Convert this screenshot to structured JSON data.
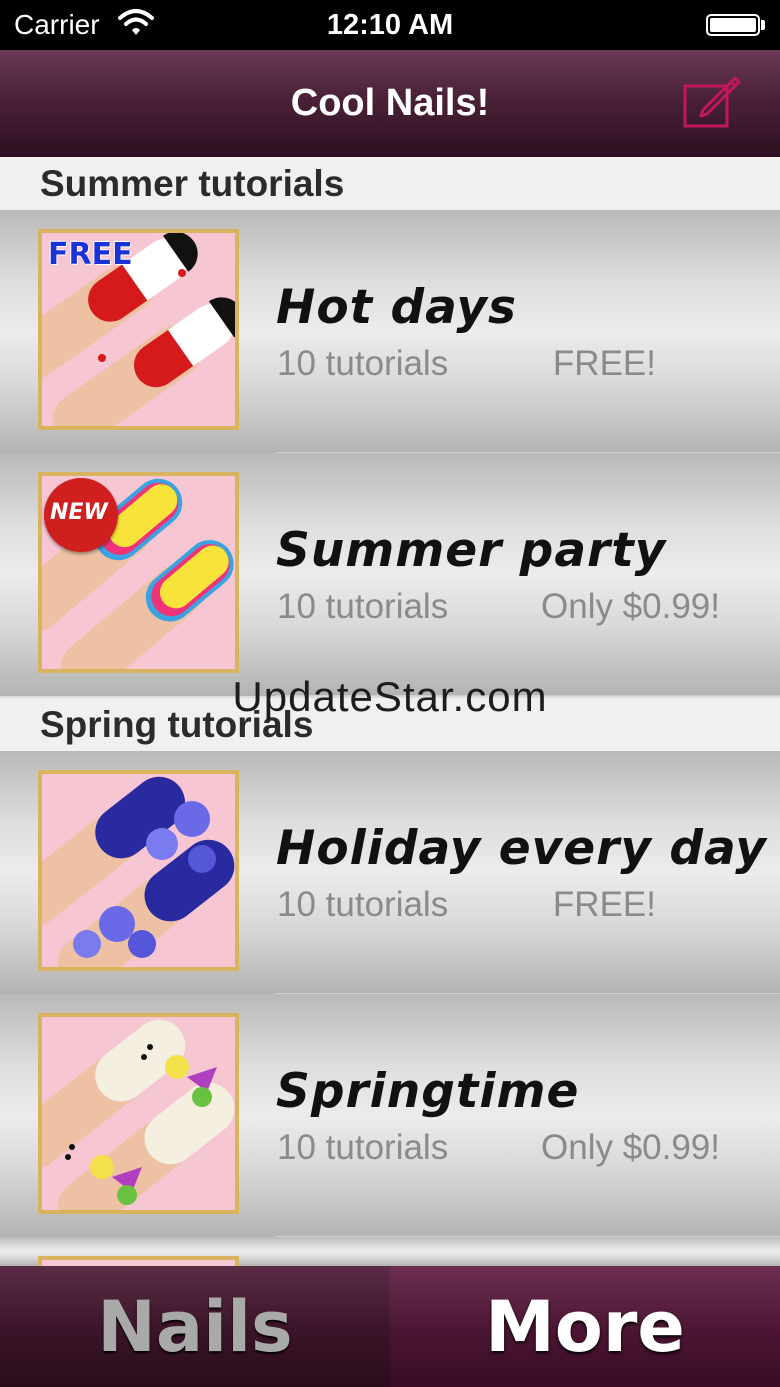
{
  "status_bar": {
    "carrier": "Carrier",
    "time": "12:10 AM"
  },
  "nav": {
    "title": "Cool Nails!"
  },
  "sections": [
    {
      "title": "Summer tutorials",
      "items": [
        {
          "title": "Hot days",
          "count": "10 tutorials",
          "price": "FREE!",
          "badge": "FREE"
        },
        {
          "title": "Summer party",
          "count": "10 tutorials",
          "price": "Only $0.99!",
          "badge": "NEW"
        }
      ]
    },
    {
      "title": "Spring tutorials",
      "items": [
        {
          "title": "Holiday every day",
          "count": "10 tutorials",
          "price": "FREE!"
        },
        {
          "title": "Springtime",
          "count": "10 tutorials",
          "price": "Only $0.99!"
        }
      ]
    }
  ],
  "watermark": "UpdateStar.com",
  "tabs": [
    {
      "label": "Nails"
    },
    {
      "label": "More"
    }
  ],
  "colors": {
    "nav_bar": "#4a2138",
    "thumb_border": "#d9b35d",
    "compose_icon": "#c2185b"
  }
}
